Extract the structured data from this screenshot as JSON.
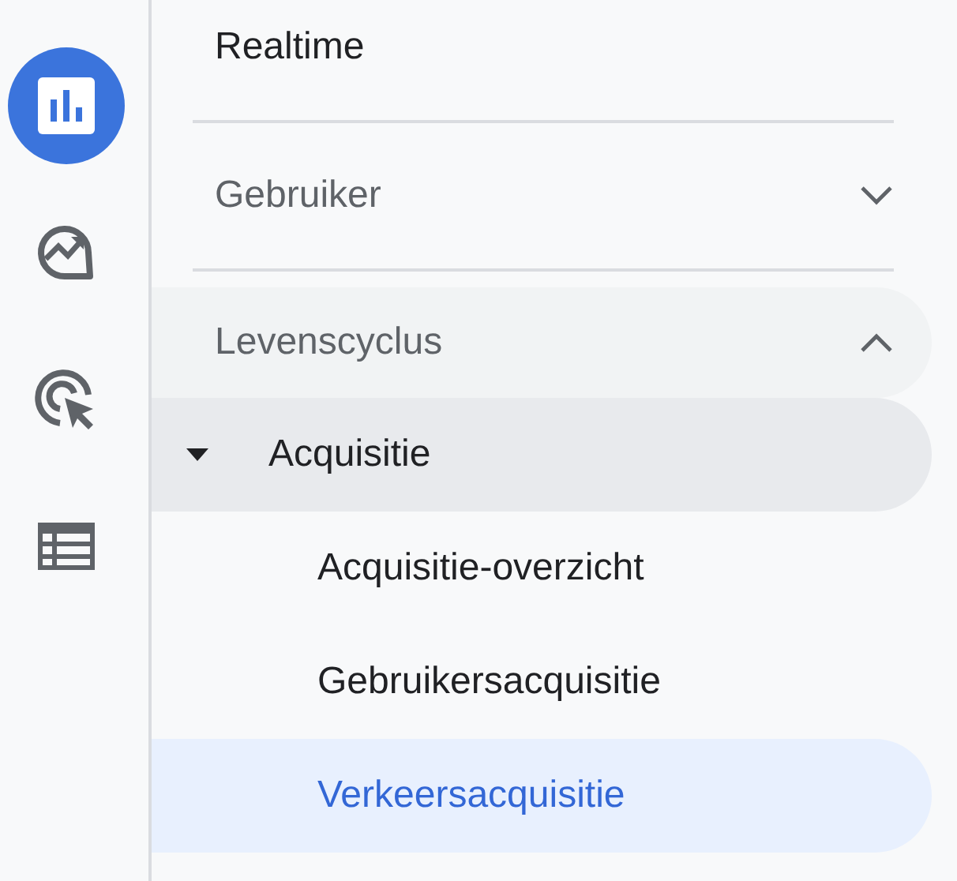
{
  "rail": [
    {
      "kind": "reports",
      "selected": true
    },
    {
      "kind": "explore",
      "selected": false
    },
    {
      "kind": "advertising",
      "selected": false
    },
    {
      "kind": "configure",
      "selected": false
    }
  ],
  "nav": [
    {
      "kind": "link",
      "label": "Realtime"
    },
    {
      "kind": "group",
      "label": "Gebruiker",
      "expanded": false
    },
    {
      "kind": "group",
      "label": "Levenscyclus",
      "expanded": true,
      "children": [
        {
          "label": "Acquisitie",
          "expanded": true,
          "children": [
            {
              "label": "Acquisitie-overzicht",
              "selected": false
            },
            {
              "label": "Gebruikersacquisitie",
              "selected": false
            },
            {
              "label": "Verkeersacquisitie",
              "selected": true
            }
          ]
        }
      ]
    }
  ]
}
